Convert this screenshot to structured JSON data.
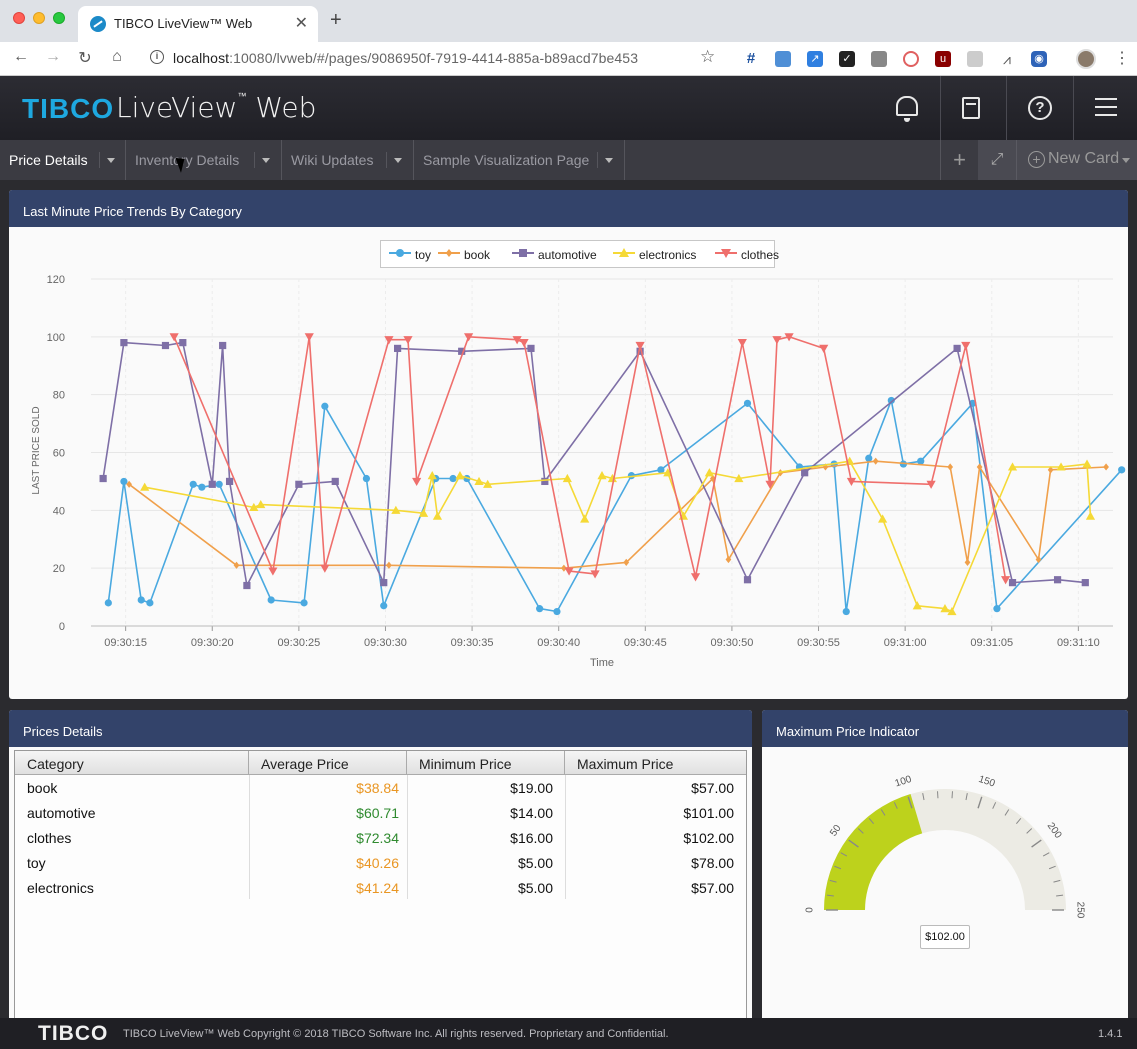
{
  "browser": {
    "tab_title": "TIBCO LiveView™ Web",
    "url_host": "localhost",
    "url_rest": ":10080/lvweb/#/pages/9086950f-7919-4414-885a-b89acd7be453"
  },
  "app": {
    "brand": "TIBCO",
    "product": "LiveView",
    "product_suffix": "Web"
  },
  "page_tabs": [
    {
      "label": "Price Details",
      "active": true
    },
    {
      "label": "Inventory Details",
      "active": false
    },
    {
      "label": "Wiki Updates",
      "active": false
    },
    {
      "label": "Sample Visualization Page",
      "active": false
    }
  ],
  "new_card_label": "New Card",
  "trend_card": {
    "title": "Last Minute Price Trends By Category"
  },
  "chart_data": {
    "type": "line",
    "title": "",
    "xlabel": "Time",
    "ylabel": "LAST PRICE SOLD",
    "ylim": [
      0,
      120
    ],
    "yticks": [
      0,
      20,
      40,
      60,
      80,
      100,
      120
    ],
    "xlim": [
      "09:30:13",
      "09:31:12"
    ],
    "xticks": [
      "09:30:15",
      "09:30:20",
      "09:30:25",
      "09:30:30",
      "09:30:35",
      "09:30:40",
      "09:30:45",
      "09:30:50",
      "09:30:55",
      "09:31:00",
      "09:31:05",
      "09:31:10"
    ],
    "grid": true,
    "legend": "top-center",
    "series": [
      {
        "name": "toy",
        "color": "#4aa9e0",
        "marker": "circle",
        "points": [
          [
            "09:30:14.0",
            8
          ],
          [
            "09:30:14.9",
            50
          ],
          [
            "09:30:15.9",
            9
          ],
          [
            "09:30:16.4",
            8
          ],
          [
            "09:30:18.9",
            49
          ],
          [
            "09:30:19.4",
            48
          ],
          [
            "09:30:20.4",
            49
          ],
          [
            "09:30:23.4",
            9
          ],
          [
            "09:30:25.3",
            8
          ],
          [
            "09:30:26.5",
            76
          ],
          [
            "09:30:28.9",
            51
          ],
          [
            "09:30:29.9",
            7
          ],
          [
            "09:30:32.9",
            51
          ],
          [
            "09:30:33.9",
            51
          ],
          [
            "09:30:34.7",
            51
          ],
          [
            "09:30:38.9",
            6
          ],
          [
            "09:30:39.9",
            5
          ],
          [
            "09:30:44.2",
            52
          ],
          [
            "09:30:45.9",
            54
          ],
          [
            "09:30:50.9",
            77
          ],
          [
            "09:30:53.9",
            55
          ],
          [
            "09:30:55.9",
            56
          ],
          [
            "09:30:56.6",
            5
          ],
          [
            "09:30:57.9",
            58
          ],
          [
            "09:30:59.2",
            78
          ],
          [
            "09:30:59.9",
            56
          ],
          [
            "09:31:00.9",
            57
          ],
          [
            "09:31:03.9",
            77
          ],
          [
            "09:31:05.3",
            6
          ],
          [
            "09:31:12.5",
            54
          ]
        ]
      },
      {
        "name": "book",
        "color": "#f0a04b",
        "marker": "diamond",
        "points": [
          [
            "09:30:15.2",
            49
          ],
          [
            "09:30:21.4",
            21
          ],
          [
            "09:30:30.2",
            21
          ],
          [
            "09:30:40.3",
            20
          ],
          [
            "09:30:43.9",
            22
          ],
          [
            "09:30:48.9",
            51
          ],
          [
            "09:30:49.8",
            23
          ],
          [
            "09:30:52.8",
            53
          ],
          [
            "09:30:55.4",
            55
          ],
          [
            "09:30:58.3",
            57
          ],
          [
            "09:31:02.6",
            55
          ],
          [
            "09:31:03.6",
            22
          ],
          [
            "09:31:04.3",
            55
          ],
          [
            "09:31:07.7",
            23
          ],
          [
            "09:31:08.4",
            54
          ],
          [
            "09:31:11.6",
            55
          ]
        ]
      },
      {
        "name": "automotive",
        "color": "#7e6fa6",
        "marker": "square",
        "points": [
          [
            "09:30:13.7",
            51
          ],
          [
            "09:30:14.9",
            98
          ],
          [
            "09:30:17.3",
            97
          ],
          [
            "09:30:18.3",
            98
          ],
          [
            "09:30:20.0",
            49
          ],
          [
            "09:30:20.6",
            97
          ],
          [
            "09:30:21.0",
            50
          ],
          [
            "09:30:22.0",
            14
          ],
          [
            "09:30:25.0",
            49
          ],
          [
            "09:30:27.1",
            50
          ],
          [
            "09:30:29.9",
            15
          ],
          [
            "09:30:30.7",
            96
          ],
          [
            "09:30:34.4",
            95
          ],
          [
            "09:30:38.4",
            96
          ],
          [
            "09:30:39.2",
            50
          ],
          [
            "09:30:44.7",
            95
          ],
          [
            "09:30:50.9",
            16
          ],
          [
            "09:30:54.2",
            53
          ],
          [
            "09:31:03.0",
            96
          ],
          [
            "09:31:06.2",
            15
          ],
          [
            "09:31:08.8",
            16
          ],
          [
            "09:31:10.4",
            15
          ]
        ]
      },
      {
        "name": "electronics",
        "color": "#f5d936",
        "marker": "triangle-up",
        "points": [
          [
            "09:30:16.1",
            48
          ],
          [
            "09:30:22.4",
            41
          ],
          [
            "09:30:22.8",
            42
          ],
          [
            "09:30:30.6",
            40
          ],
          [
            "09:30:32.2",
            39
          ],
          [
            "09:30:32.7",
            52
          ],
          [
            "09:30:33.0",
            38
          ],
          [
            "09:30:34.3",
            52
          ],
          [
            "09:30:35.4",
            50
          ],
          [
            "09:30:35.9",
            49
          ],
          [
            "09:30:40.5",
            51
          ],
          [
            "09:30:41.5",
            37
          ],
          [
            "09:30:42.5",
            52
          ],
          [
            "09:30:43.1",
            51
          ],
          [
            "09:30:46.3",
            53
          ],
          [
            "09:30:47.2",
            38
          ],
          [
            "09:30:48.7",
            53
          ],
          [
            "09:30:50.4",
            51
          ],
          [
            "09:30:56.8",
            57
          ],
          [
            "09:30:58.7",
            37
          ],
          [
            "09:31:00.7",
            7
          ],
          [
            "09:31:02.3",
            6
          ],
          [
            "09:31:02.7",
            5
          ],
          [
            "09:31:06.2",
            55
          ],
          [
            "09:31:09.0",
            55
          ],
          [
            "09:31:10.5",
            56
          ],
          [
            "09:31:10.7",
            38
          ]
        ]
      },
      {
        "name": "clothes",
        "color": "#ef6f6c",
        "marker": "triangle-down",
        "points": [
          [
            "09:30:17.8",
            100
          ],
          [
            "09:30:23.5",
            19
          ],
          [
            "09:30:25.6",
            100
          ],
          [
            "09:30:26.5",
            20
          ],
          [
            "09:30:30.2",
            99
          ],
          [
            "09:30:31.3",
            99
          ],
          [
            "09:30:31.8",
            50
          ],
          [
            "09:30:34.8",
            100
          ],
          [
            "09:30:37.6",
            99
          ],
          [
            "09:30:38.0",
            98
          ],
          [
            "09:30:40.6",
            19
          ],
          [
            "09:30:42.1",
            18
          ],
          [
            "09:30:44.7",
            97
          ],
          [
            "09:30:47.9",
            17
          ],
          [
            "09:30:50.6",
            98
          ],
          [
            "09:30:52.2",
            49
          ],
          [
            "09:30:52.6",
            99
          ],
          [
            "09:30:53.3",
            100
          ],
          [
            "09:30:55.3",
            96
          ],
          [
            "09:30:56.9",
            50
          ],
          [
            "09:31:01.5",
            49
          ],
          [
            "09:31:03.5",
            97
          ],
          [
            "09:31:05.8",
            16
          ]
        ]
      }
    ]
  },
  "prices_card": {
    "title": "Prices Details",
    "columns": [
      "Category",
      "Average Price",
      "Minimum Price",
      "Maximum Price"
    ],
    "rows": [
      {
        "category": "book",
        "avg": "$38.84",
        "avg_color": "#e99623",
        "min": "$19.00",
        "max": "$57.00"
      },
      {
        "category": "automotive",
        "avg": "$60.71",
        "avg_color": "#2f8a2f",
        "min": "$14.00",
        "max": "$101.00"
      },
      {
        "category": "clothes",
        "avg": "$72.34",
        "avg_color": "#2f8a2f",
        "min": "$16.00",
        "max": "$102.00"
      },
      {
        "category": "toy",
        "avg": "$40.26",
        "avg_color": "#e99623",
        "min": "$5.00",
        "max": "$78.00"
      },
      {
        "category": "electronics",
        "avg": "$41.24",
        "avg_color": "#e99623",
        "min": "$5.00",
        "max": "$57.00"
      }
    ]
  },
  "gauge_card": {
    "title": "Maximum Price Indicator",
    "value": 102,
    "value_label": "$102.00",
    "min": 0,
    "max": 250,
    "tick_labels": [
      "0",
      "50",
      "100",
      "150",
      "200",
      "250"
    ],
    "fill_color": "#bdd21c",
    "track_color": "#ecebe4"
  },
  "footer": {
    "brand": "TIBCO",
    "text": "TIBCO LiveView™ Web Copyright © 2018 TIBCO Software Inc. All rights reserved. Proprietary and Confidential.",
    "version": "1.4.1"
  }
}
